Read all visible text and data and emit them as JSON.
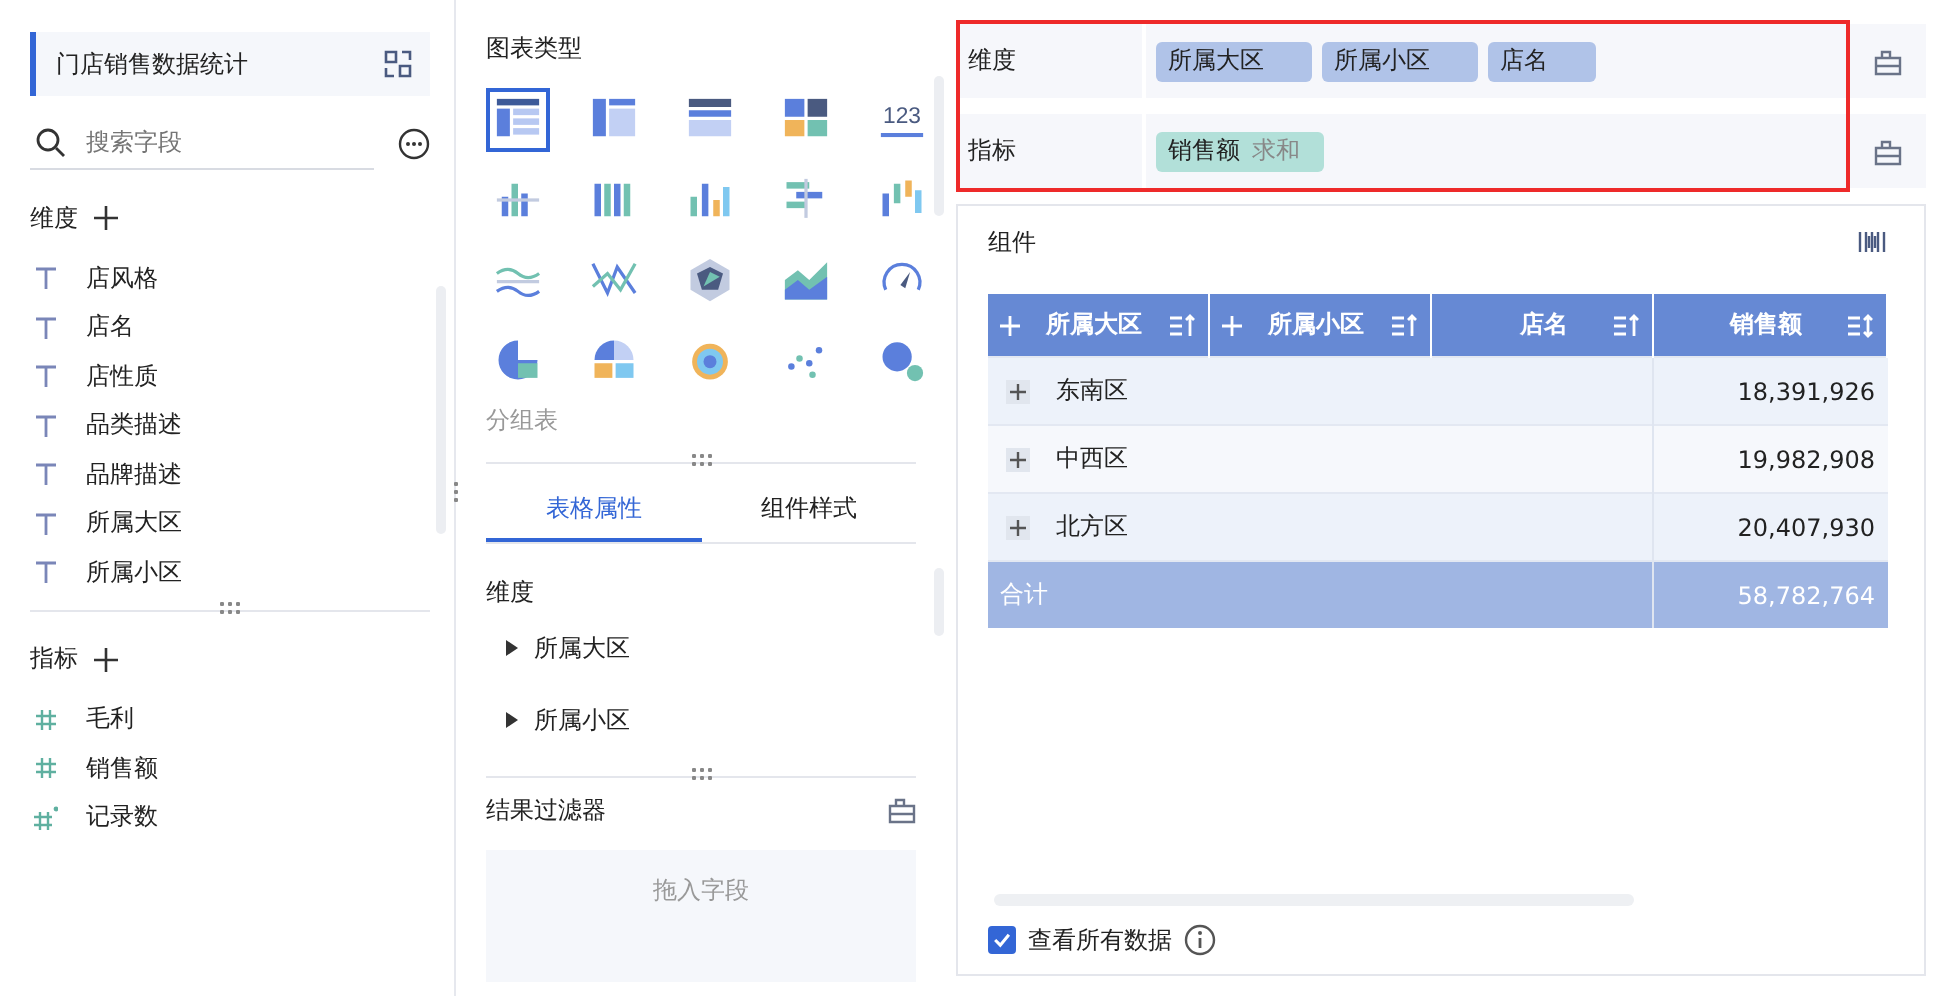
{
  "dataset": {
    "title": "门店销售数据统计"
  },
  "search": {
    "placeholder": "搜索字段"
  },
  "dimension_section": {
    "title": "维度"
  },
  "dimension_fields": [
    {
      "label": "店风格",
      "kind": "text"
    },
    {
      "label": "店名",
      "kind": "text"
    },
    {
      "label": "店性质",
      "kind": "text"
    },
    {
      "label": "品类描述",
      "kind": "text"
    },
    {
      "label": "品牌描述",
      "kind": "text"
    },
    {
      "label": "所属大区",
      "kind": "text"
    },
    {
      "label": "所属小区",
      "kind": "text"
    }
  ],
  "measure_section": {
    "title": "指标"
  },
  "measure_fields": [
    {
      "label": "毛利",
      "kind": "number"
    },
    {
      "label": "销售额",
      "kind": "number"
    },
    {
      "label": "记录数",
      "kind": "count"
    }
  ],
  "chart_type_panel": {
    "title": "图表类型",
    "hint": "分组表"
  },
  "chart_types": [
    {
      "selected": true
    },
    {
      "selected": false
    },
    {
      "selected": false
    },
    {
      "selected": false
    },
    {
      "selected": false,
      "glyph": "123"
    },
    {
      "selected": false
    },
    {
      "selected": false
    },
    {
      "selected": false
    },
    {
      "selected": false
    },
    {
      "selected": false
    },
    {
      "selected": false
    },
    {
      "selected": false
    },
    {
      "selected": false
    },
    {
      "selected": false
    },
    {
      "selected": false
    },
    {
      "selected": false
    },
    {
      "selected": false
    },
    {
      "selected": false
    },
    {
      "selected": false
    },
    {
      "selected": false
    }
  ],
  "property_tabs": [
    {
      "label": "表格属性",
      "selected": true
    },
    {
      "label": "组件样式",
      "selected": false
    }
  ],
  "table_properties": {
    "title": "维度",
    "items": [
      "所属大区",
      "所属小区"
    ]
  },
  "result_filter": {
    "title": "结果过滤器",
    "placeholder": "拖入字段"
  },
  "field_wells": {
    "highlighted": true,
    "rows": [
      {
        "label": "维度",
        "kind": "dimension",
        "chips": [
          {
            "label": "所属大区"
          },
          {
            "label": "所属小区"
          },
          {
            "label": "店名"
          }
        ]
      },
      {
        "label": "指标",
        "kind": "measure",
        "chips": [
          {
            "label": "销售额",
            "aggregation": "求和"
          }
        ]
      }
    ]
  },
  "component": {
    "title": "组件"
  },
  "table": {
    "columns": [
      {
        "label": "所属大区",
        "expandable": true,
        "sorted": true
      },
      {
        "label": "所属小区",
        "expandable": true,
        "sorted": true
      },
      {
        "label": "店名",
        "expandable": false,
        "sorted": true
      },
      {
        "label": "销售额",
        "expandable": false,
        "sorted": false
      }
    ],
    "rows": [
      {
        "region": "东南区",
        "sales": "18,391,926"
      },
      {
        "region": "中西区",
        "sales": "19,982,908"
      },
      {
        "region": "北方区",
        "sales": "20,407,930"
      }
    ],
    "total": {
      "label": "合计",
      "sales": "58,782,764"
    }
  },
  "view_all_data": {
    "label": "查看所有数据",
    "checked": true
  }
}
